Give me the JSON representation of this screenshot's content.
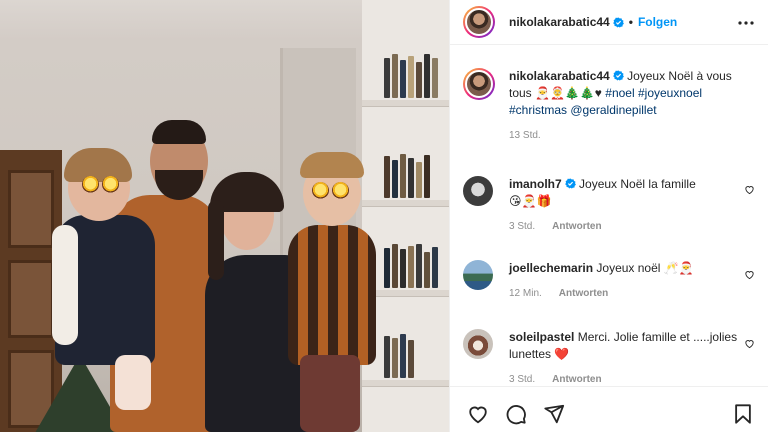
{
  "post": {
    "username": "nikolakarabatic44",
    "follow_label": "Folgen",
    "separator": "•",
    "caption_text": "Joyeux Noël à vous tous",
    "caption_emojis": "🎅🤶🎄🎄♥",
    "hashtags": [
      "#noel",
      "#joyeuxnoel",
      "#christmas"
    ],
    "mention": "@geraldinepillet",
    "time": "13 Std."
  },
  "comments": [
    {
      "username": "imanolh7",
      "verified": true,
      "text": "Joyeux Noël la famille",
      "emojis": "😘🎅🎁",
      "time": "3 Std.",
      "reply_label": "Antworten"
    },
    {
      "username": "joellechemarin",
      "verified": false,
      "text": "Joyeux noël",
      "emojis": "🥂🎅",
      "time": "12 Min.",
      "reply_label": "Antworten"
    },
    {
      "username": "soleilpastel",
      "verified": false,
      "text": "Merci. Jolie famille et .....jolies lunettes",
      "emojis": "❤️",
      "time": "3 Std.",
      "reply_label": "Antworten"
    }
  ],
  "icons": {
    "more": "more-options-icon",
    "verified": "verified-badge-icon",
    "like": "heart-icon",
    "comment": "comment-icon",
    "share": "share-icon",
    "save": "bookmark-icon"
  },
  "colors": {
    "link": "#00376b",
    "follow": "#0095f6",
    "muted": "#8e8e8e",
    "verified": "#0095f6"
  }
}
